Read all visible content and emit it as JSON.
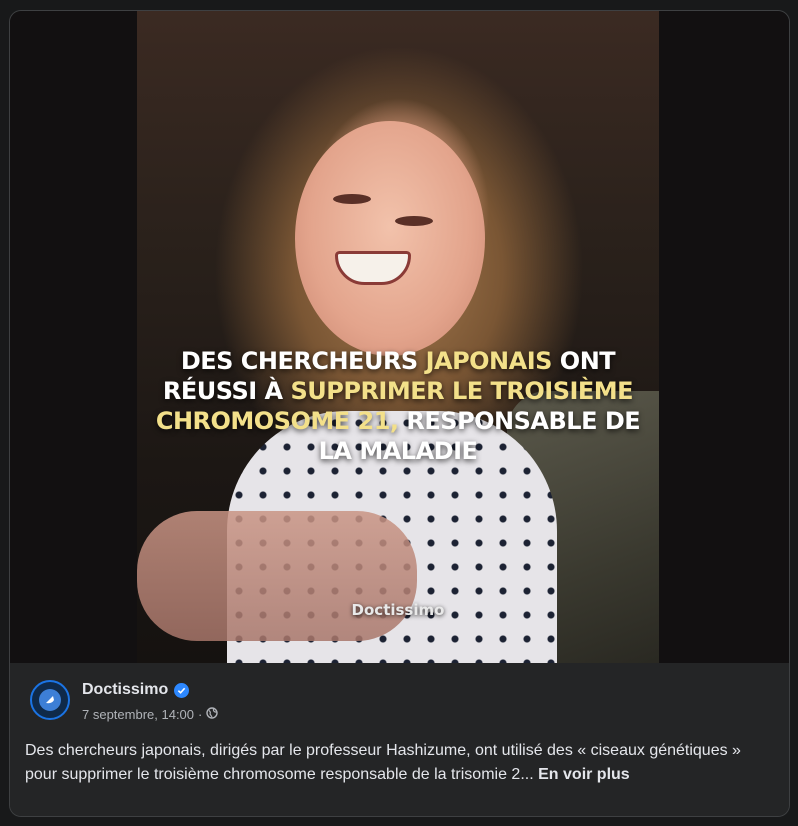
{
  "post": {
    "media": {
      "headline_parts": [
        {
          "text": "DES CHERCHEURS ",
          "highlight": false
        },
        {
          "text": "JAPONAIS",
          "highlight": true
        },
        {
          "text": " ONT",
          "highlight": false
        },
        {
          "text": "RÉUSSI À ",
          "highlight": false
        },
        {
          "text": "SUPPRIMER LE TROISIÈME",
          "highlight": true
        },
        {
          "text": "CHROMOSOME 21,",
          "highlight": true
        },
        {
          "text": " RESPONSABLE DE",
          "highlight": false
        },
        {
          "text": "LA MALADIE",
          "highlight": false
        }
      ],
      "watermark": "Doctissimo",
      "highlight_color": "#f3e08a"
    },
    "author": {
      "name": "Doctissimo",
      "verified_icon": "verified-badge-icon",
      "avatar_icon": "doctissimo-logo-icon"
    },
    "timestamp": "7 septembre, 14:00",
    "separator": "·",
    "audience_icon": "globe-icon",
    "text": "Des chercheurs japonais, dirigés par le professeur Hashizume, ont utilisé des « ciseaux génétiques » pour supprimer le troisième chromosome responsable de la trisomie 2...",
    "see_more": "En voir plus"
  },
  "colors": {
    "card_background": "#242526",
    "text_primary": "#e4e6eb",
    "text_secondary": "#b0b3b8",
    "verified": "#2d88ff"
  }
}
